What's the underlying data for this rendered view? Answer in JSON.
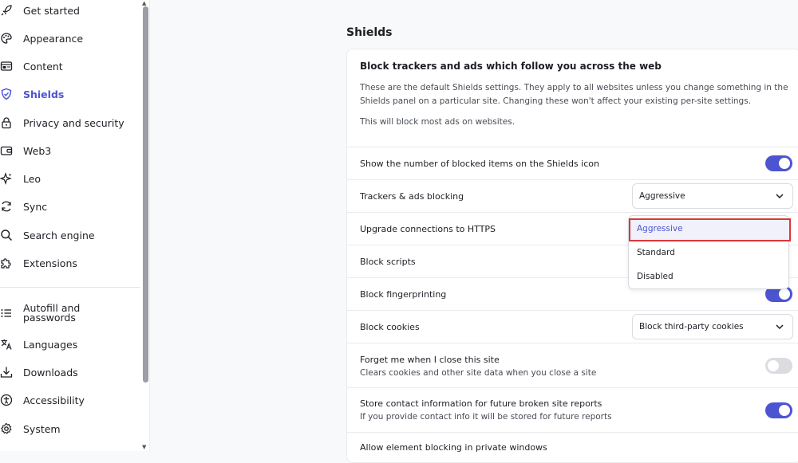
{
  "sidebar": {
    "items": [
      {
        "label": "Get started",
        "icon": "rocket-icon"
      },
      {
        "label": "Appearance",
        "icon": "palette-icon"
      },
      {
        "label": "Content",
        "icon": "content-icon"
      },
      {
        "label": "Shields",
        "icon": "shield-icon",
        "active": true
      },
      {
        "label": "Privacy and security",
        "icon": "lock-icon"
      },
      {
        "label": "Web3",
        "icon": "wallet-icon"
      },
      {
        "label": "Leo",
        "icon": "sparkle-icon"
      },
      {
        "label": "Sync",
        "icon": "sync-icon"
      },
      {
        "label": "Search engine",
        "icon": "search-icon"
      },
      {
        "label": "Extensions",
        "icon": "puzzle-icon"
      },
      {
        "label": "Autofill and passwords",
        "icon": "list-icon"
      },
      {
        "label": "Languages",
        "icon": "translate-icon"
      },
      {
        "label": "Downloads",
        "icon": "download-icon"
      },
      {
        "label": "Accessibility",
        "icon": "accessibility-icon"
      },
      {
        "label": "System",
        "icon": "gear-icon"
      }
    ]
  },
  "main": {
    "section_title": "Shields",
    "card": {
      "heading": "Block trackers and ads which follow you across the web",
      "desc1": "These are the default Shields settings. They apply to all websites unless you change something in the Shields panel on a particular site. Changing these won't affect your existing per-site settings.",
      "desc2": "This will block most ads on websites.",
      "rows": {
        "show_count": {
          "label": "Show the number of blocked items on the Shields icon",
          "on": true
        },
        "trackers": {
          "label": "Trackers & ads blocking",
          "value": "Aggressive"
        },
        "https": {
          "label": "Upgrade connections to HTTPS"
        },
        "scripts": {
          "label": "Block scripts"
        },
        "fingerprinting": {
          "label": "Block fingerprinting",
          "on": true
        },
        "cookies": {
          "label": "Block cookies",
          "value": "Block third-party cookies"
        },
        "forget": {
          "label": "Forget me when I close this site",
          "sub": "Clears cookies and other site data when you close a site",
          "on": false
        },
        "contact": {
          "label": "Store contact information for future broken site reports",
          "sub": "If you provide contact info it will be stored for future reports",
          "on": true
        },
        "element_blocking": {
          "label": "Allow element blocking in private windows"
        }
      }
    }
  },
  "dropdown": {
    "options": [
      "Aggressive",
      "Standard",
      "Disabled"
    ],
    "selected": "Aggressive"
  },
  "colors": {
    "accent": "#4c54d2",
    "highlight_border": "#d9373b"
  }
}
